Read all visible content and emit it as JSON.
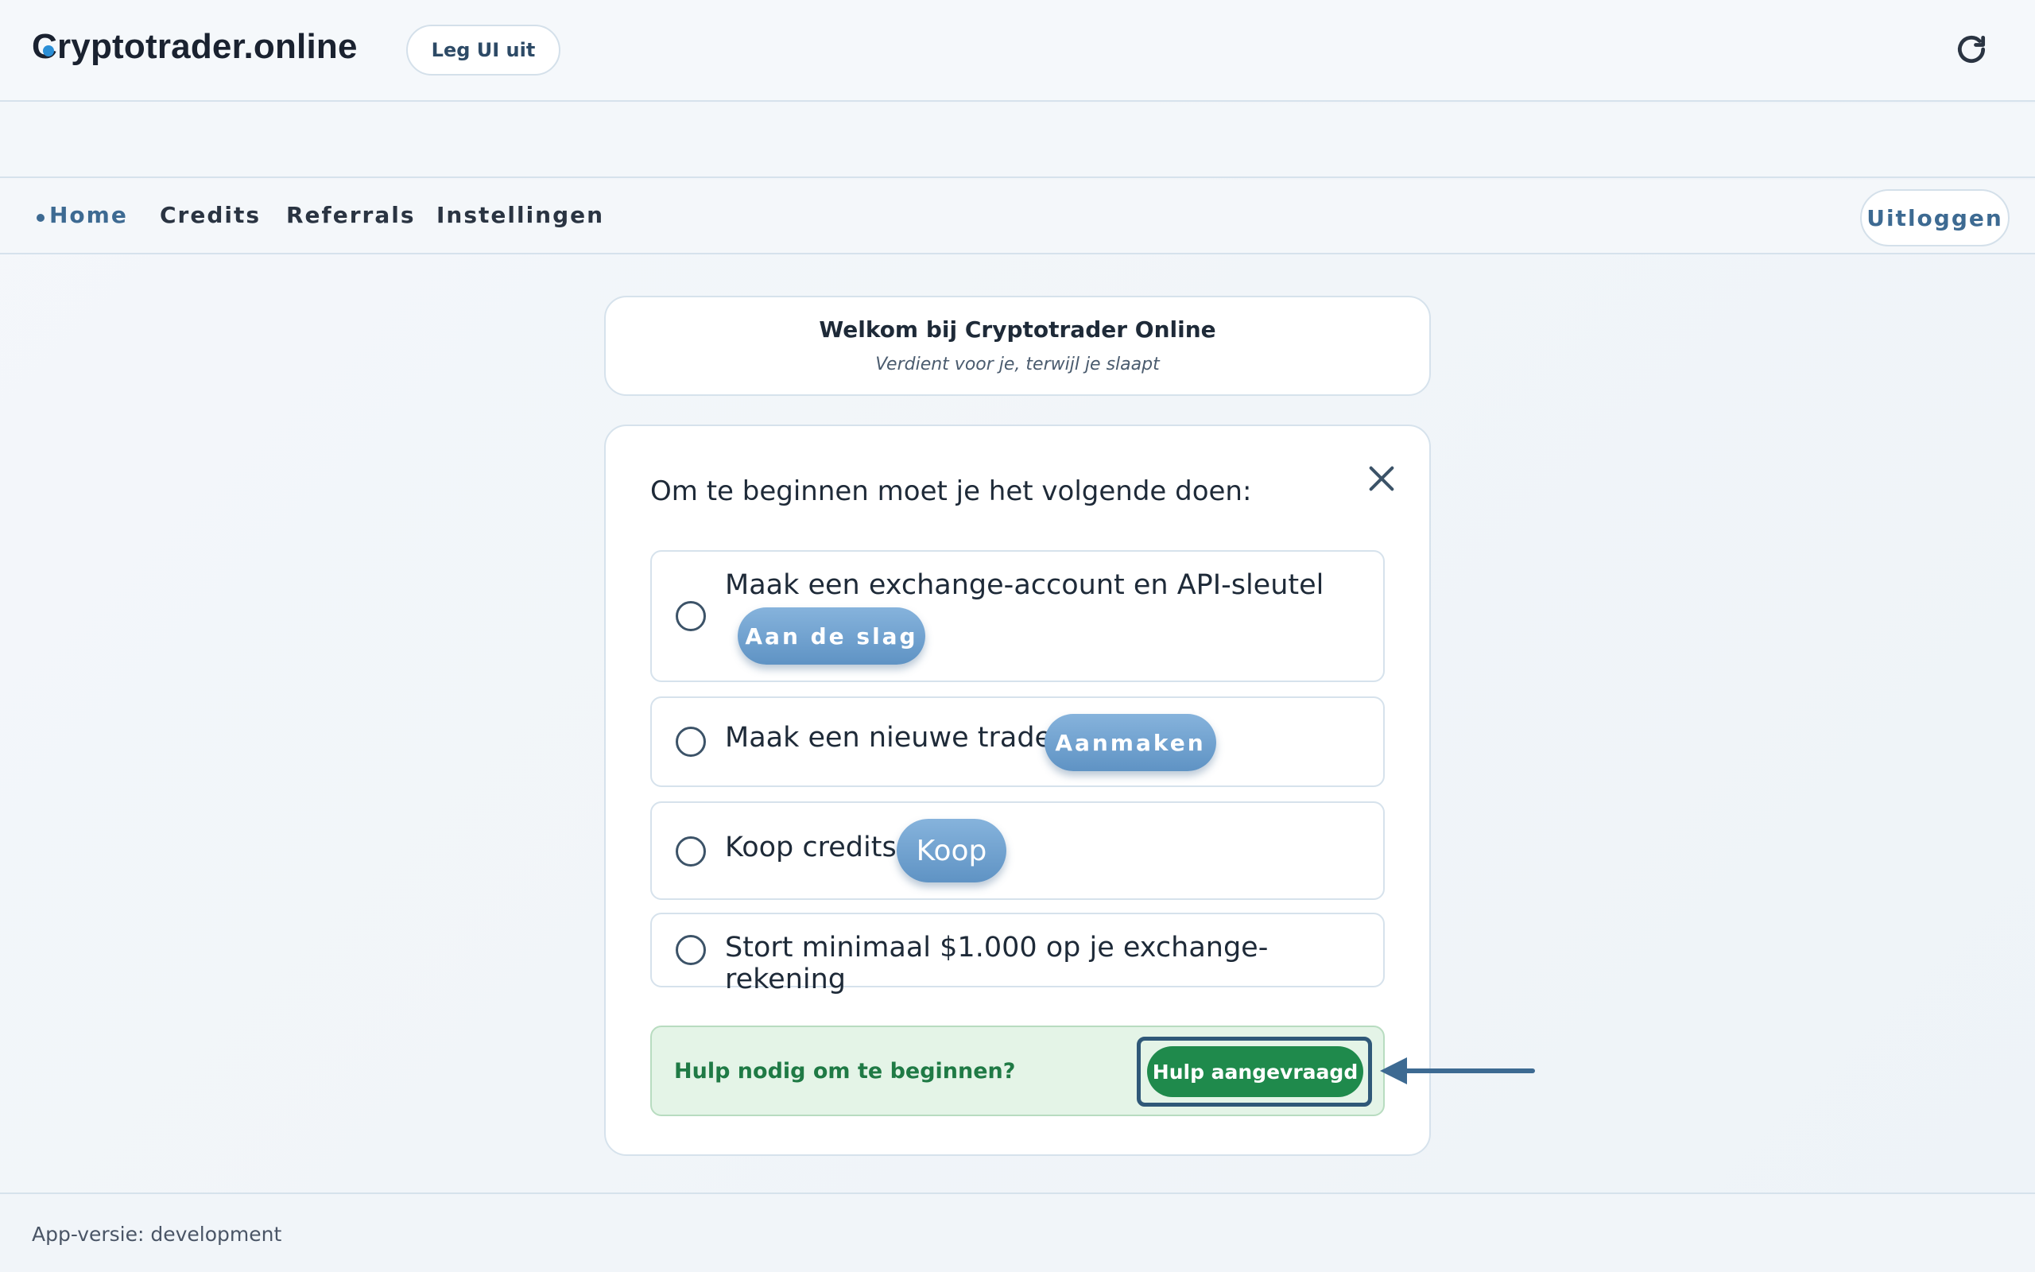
{
  "header": {
    "brand": "Cryptotrader.online",
    "explain_label": "Leg UI uit"
  },
  "nav": {
    "items": [
      {
        "label": "Home",
        "active": true
      },
      {
        "label": "Credits",
        "active": false
      },
      {
        "label": "Referrals",
        "active": false
      },
      {
        "label": "Instellingen",
        "active": false
      }
    ],
    "logout_label": "Uitloggen"
  },
  "welcome": {
    "title": "Welkom bij Cryptotrader Online",
    "subtitle": "Verdient voor je, terwijl je slaapt"
  },
  "onboarding": {
    "title": "Om te beginnen moet je het volgende doen:",
    "steps": [
      {
        "label": "Maak een exchange-account en API-sleutel",
        "action": "Aan de slag"
      },
      {
        "label": "Maak een nieuwe trader",
        "action": "Aanmaken"
      },
      {
        "label": "Koop credits",
        "action": "Koop"
      },
      {
        "label": "Stort minimaal $1.000 op je exchange-rekening",
        "action": ""
      }
    ],
    "help_text": "Hulp nodig om te beginnen?",
    "help_button": "Hulp aangevraagd"
  },
  "footer": {
    "version_text": "App-versie: development"
  },
  "colors": {
    "accent": "#3d6a92",
    "pill": "#6c9fcf",
    "help_green": "#1f8a4c",
    "help_bg": "#e4f4e7"
  }
}
